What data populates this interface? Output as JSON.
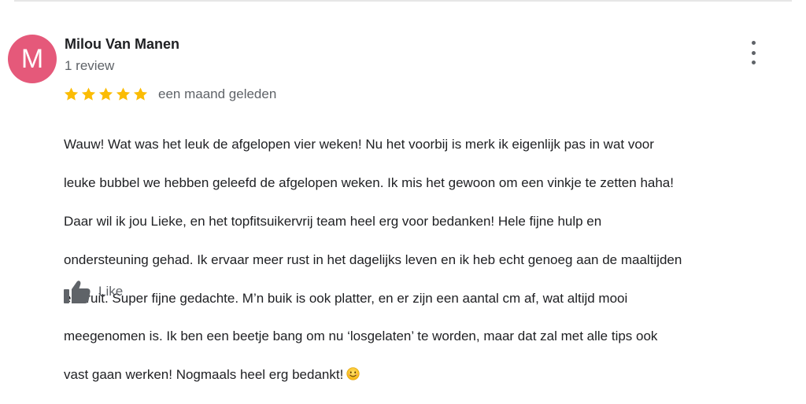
{
  "review": {
    "author": {
      "initial": "M",
      "name": "Milou Van Manen",
      "review_count": "1 review",
      "avatar_color": "#e5597a"
    },
    "rating": 5,
    "rating_max": 5,
    "star_color": "#fbbc04",
    "date": "een maand geleden",
    "lines": [
      "Wauw! Wat was het leuk de afgelopen vier weken! Nu het voorbij is merk ik eigenlijk pas in wat voor",
      "leuke bubbel we hebben geleefd de afgelopen weken. Ik mis het gewoon om een vinkje te zetten haha!",
      "Daar wil ik jou Lieke, en het topfitsuikervrij team heel erg voor bedanken! Hele fijne hulp en",
      "ondersteuning gehad. Ik ervaar meer rust in het dagelijks leven en ik heb echt genoeg aan de maaltijden",
      "en fruit. Super fijne gedachte. M’n buik is ook platter, en er zijn een aantal cm af, wat altijd mooi",
      "meegenomen is. Ik ben een beetje bang om nu ‘losgelaten’ te worden, maar dat zal met alle tips ook",
      "vast gaan werken! Nogmaals heel erg bedankt!"
    ],
    "emoji_icon": "smiling-face-emoji",
    "more_icon": "more-vert-icon",
    "like": {
      "label": "Like",
      "icon": "thumbs-up-icon"
    }
  }
}
